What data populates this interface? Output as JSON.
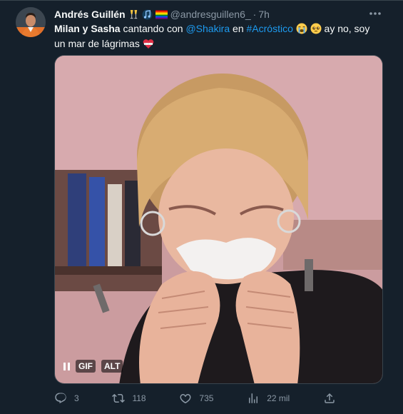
{
  "author": {
    "display_name": "Andrés Guillén",
    "emojis": [
      "champagne-emoji",
      "music-note-emoji",
      "rainbow-flag-emoji"
    ],
    "handle": "@andresguillen6_",
    "separator": "·",
    "time": "7h"
  },
  "tweet_text": {
    "part1_bold": "Milan y Sasha",
    "part2": " cantando con ",
    "mention": "@Shakira",
    "part3": " en ",
    "hashtag": "#Acróstico",
    "part4": " ay no, soy un mar de lágrimas "
  },
  "text_emojis": [
    "loudly-crying-face-emoji",
    "pleading-face-emoji",
    "mending-heart-emoji"
  ],
  "media": {
    "gif_label": "GIF",
    "alt_label": "ALT"
  },
  "actions": {
    "replies": "3",
    "retweets": "118",
    "likes": "735",
    "views": "22 mil"
  },
  "icons": {
    "more": "more-icon",
    "reply": "reply-icon",
    "retweet": "retweet-icon",
    "like": "heart-icon",
    "views": "views-icon",
    "share": "share-icon",
    "pause": "pause-icon"
  },
  "colors": {
    "background": "#15202b",
    "text": "#f7f9f9",
    "muted": "#8b98a5",
    "link": "#1d9bf0",
    "border": "#38444d"
  }
}
